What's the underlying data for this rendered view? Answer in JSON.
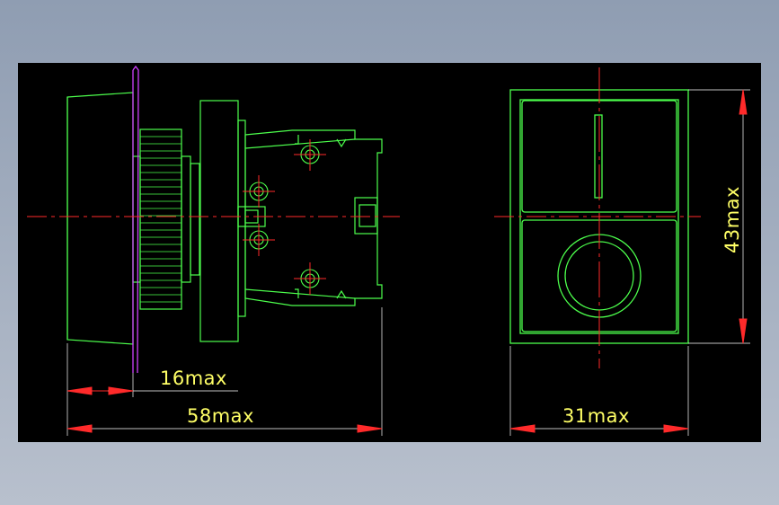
{
  "dimensions": {
    "flange_depth": "16max",
    "overall_length": "58max",
    "width": "31max",
    "height": "43max"
  },
  "colors": {
    "background": "#000000",
    "outline": "#4cff4c",
    "centerline": "#ff2a2a",
    "panel": "#d040ff",
    "dimension_text": "#ffff66",
    "arrows": "#ff2a2a"
  }
}
